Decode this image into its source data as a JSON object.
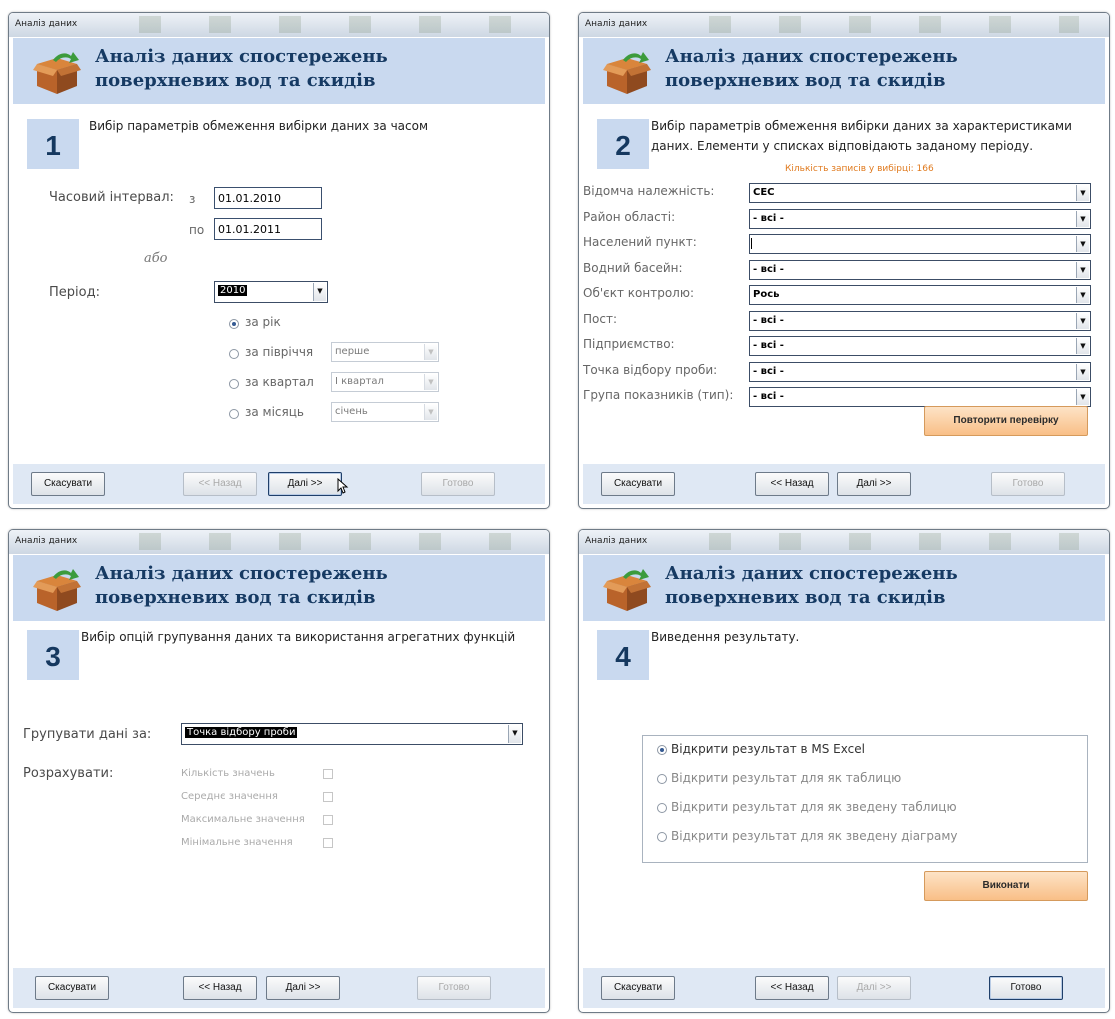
{
  "windows": [
    {
      "title": "Аналіз даних",
      "header_line1": "Аналіз даних спостережень",
      "header_line2": "поверхневих вод та скидів",
      "step": "1",
      "description": "Вибір параметрів обмеження вибірки даних за часом",
      "time_interval_label": "Часовий інтервал:",
      "from_label": "з",
      "to_label": "по",
      "from_value": "01.01.2010",
      "to_value": "01.01.2011",
      "or_label": "або",
      "period_label": "Період:",
      "period_value": "2010",
      "radio_year": "за рік",
      "radio_half": "за півріччя",
      "half_value": "перше",
      "radio_quarter": "за квартал",
      "quarter_value": "І квартал",
      "radio_month": "за місяць",
      "month_value": "січень",
      "cancel": "Скасувати",
      "back": "<< Назад",
      "next": "Далі >>",
      "finish": "Готово"
    },
    {
      "title": "Аналіз даних",
      "header_line1": "Аналіз даних спостережень",
      "header_line2": "поверхневих вод та скидів",
      "step": "2",
      "description_line1": "Вибір параметрів обмеження вибірки даних за характеристиками",
      "description_line2": "даних. Елементи у списках відповідають заданому періоду.",
      "record_count": "Кількість записів у вибірці: 166",
      "fields": [
        {
          "label": "Відомча належність:",
          "value": "CEC"
        },
        {
          "label": "Район області:",
          "value": "- всі -"
        },
        {
          "label": "Населений пункт:",
          "value": ""
        },
        {
          "label": "Водний басейн:",
          "value": "- всі -"
        },
        {
          "label": "Об'єкт контролю:",
          "value": "Рось"
        },
        {
          "label": "Пост:",
          "value": "- всі -"
        },
        {
          "label": "Підприємство:",
          "value": "- всі -"
        },
        {
          "label": "Точка відбору проби:",
          "value": "- всі -"
        },
        {
          "label": "Група показників (тип):",
          "value": "- всі -"
        }
      ],
      "recheck": "Повторити перевірку",
      "cancel": "Скасувати",
      "back": "<< Назад",
      "next": "Далі >>",
      "finish": "Готово"
    },
    {
      "title": "Аналіз даних",
      "header_line1": "Аналіз даних спостережень",
      "header_line2": "поверхневих вод та скидів",
      "step": "3",
      "description": "Вибір опцій групування даних та використання агрегатних функцій",
      "group_label": "Групувати дані за:",
      "group_value": "Точка відбору проби",
      "calc_label": "Розрахувати:",
      "options": [
        "Кількість значень",
        "Середнє значення",
        "Максимальне значення",
        "Мінімальне значення"
      ],
      "cancel": "Скасувати",
      "back": "<< Назад",
      "next": "Далі >>",
      "finish": "Готово"
    },
    {
      "title": "Аналіз даних",
      "header_line1": "Аналіз даних спостережень",
      "header_line2": "поверхневих вод та скидів",
      "step": "4",
      "description": "Виведення результату.",
      "results": [
        "Відкрити результат в MS Excel",
        "Відкрити результат для як таблицю",
        "Відкрити результат для як зведену таблицю",
        "Відкрити результат для як зведену діаграму"
      ],
      "execute": "Виконати",
      "cancel": "Скасувати",
      "back": "<< Назад",
      "next": "Далі >>",
      "finish": "Готово"
    }
  ]
}
